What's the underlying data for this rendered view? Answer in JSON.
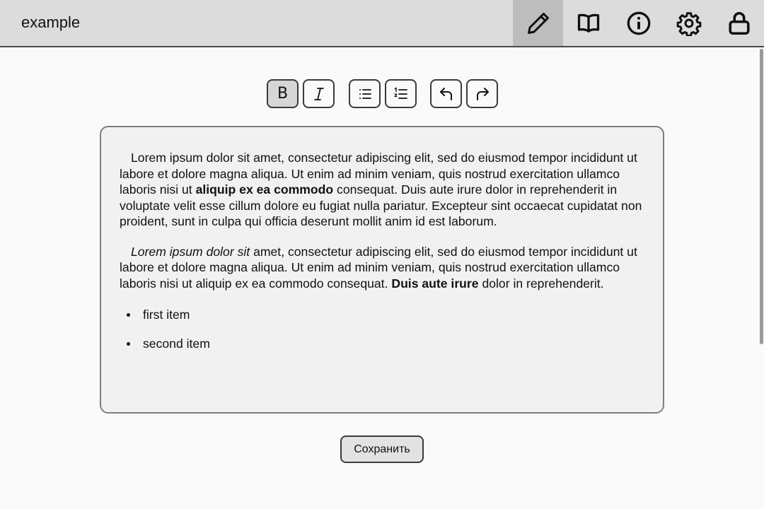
{
  "header": {
    "title": "example",
    "icons": [
      "pencil-icon",
      "book-icon",
      "info-icon",
      "gear-icon",
      "lock-icon"
    ],
    "active_icon": "pencil-icon"
  },
  "toolbar": {
    "buttons": [
      "bold-button",
      "italic-button",
      "bullet-list-button",
      "numbered-list-button",
      "undo-button",
      "redo-button"
    ],
    "bold_label": "B",
    "active_button": "bold-button"
  },
  "editor": {
    "paragraph_1": {
      "before": "Lorem ipsum dolor sit amet, consectetur adipiscing elit, sed do eiusmod tempor incididunt ut labore et dolore magna aliqua. Ut enim ad minim veniam, quis nostrud exercitation ullamco laboris nisi ut ",
      "bold": "aliquip ex ea commodo",
      "after": " consequat. Duis aute irure dolor in reprehenderit in voluptate velit esse cillum dolore eu fugiat nulla pariatur. Excepteur sint occaecat cupidatat non proident, sunt in culpa qui officia deserunt mollit anim id est laborum."
    },
    "paragraph_2": {
      "italic": "Lorem ipsum dolor sit",
      "middle": " amet, consectetur adipiscing elit, sed do eiusmod tempor incididunt ut labore et dolore magna aliqua. Ut enim ad minim veniam, quis nostrud exercitation ullamco laboris nisi ut aliquip ex ea commodo consequat. ",
      "bold": "Duis aute irure",
      "after": " dolor in reprehenderit."
    },
    "list_items": [
      "first item",
      "second item"
    ]
  },
  "save_label": "Сохранить",
  "colors": {
    "topbar": "#dcdcdc",
    "active_tab": "#bdbdbd",
    "editor_bg": "#f1f1f1",
    "page_bg": "#fafafa"
  }
}
